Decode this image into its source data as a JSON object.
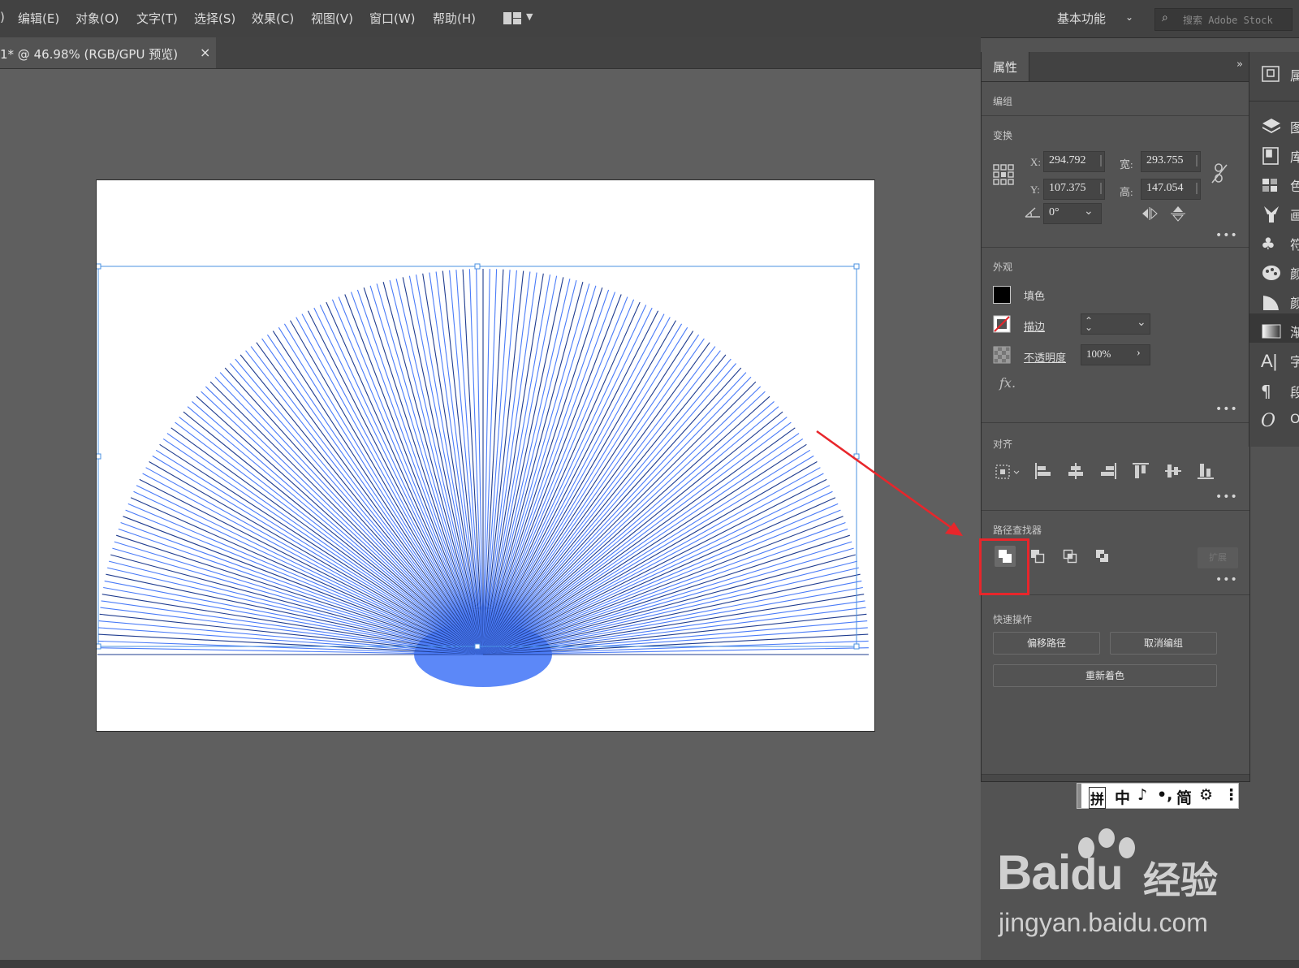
{
  "menu": {
    "items": [
      ")",
      "编辑(E)",
      "对象(O)",
      "文字(T)",
      "选择(S)",
      "效果(C)",
      "视图(V)",
      "窗口(W)",
      "帮助(H)"
    ],
    "workspace_icon": "workspace-grid-icon",
    "essentials": "基本功能",
    "search_placeholder": "搜索 Adobe Stock"
  },
  "document_tab": {
    "title": "1* @ 46.98% (RGB/GPU 预览)",
    "close": "×"
  },
  "properties": {
    "tab_label": "属性",
    "collapse": "»",
    "selection_type": "编组",
    "transform": {
      "title": "变换",
      "x_label": "X:",
      "x_value": "294.792",
      "y_label": "Y:",
      "y_value": "107.375",
      "w_label": "宽:",
      "w_value": "293.755",
      "h_label": "高:",
      "h_value": "147.054",
      "angle_value": "0°"
    },
    "appearance": {
      "title": "外观",
      "fill_label": "填色",
      "stroke_label": "描边",
      "opacity_label": "不透明度",
      "opacity_value": "100%",
      "fx_label": "fx."
    },
    "align": {
      "title": "对齐"
    },
    "pathfinder": {
      "title": "路径查找器",
      "expand_label": "扩展"
    },
    "quick_actions": {
      "title": "快速操作",
      "offset_path": "偏移路径",
      "ungroup": "取消编组",
      "recolor": "重新着色"
    },
    "more": "•••"
  },
  "dock": {
    "items": [
      {
        "icon": "properties-icon",
        "label": "属"
      },
      {
        "icon": "layers-icon",
        "label": "图"
      },
      {
        "icon": "libraries-icon",
        "label": "库"
      },
      {
        "icon": "swatches-icon",
        "label": "色"
      },
      {
        "icon": "brushes-icon",
        "label": "画"
      },
      {
        "icon": "symbols-icon",
        "label": "符"
      },
      {
        "icon": "color-icon",
        "label": "颜"
      },
      {
        "icon": "color-guide-icon",
        "label": "颜"
      },
      {
        "icon": "gradient-icon",
        "label": "渐"
      },
      {
        "icon": "character-icon",
        "label": "字"
      },
      {
        "icon": "paragraph-icon",
        "label": "段"
      },
      {
        "icon": "opentype-icon",
        "label": "O"
      }
    ]
  },
  "ime": {
    "items": [
      "拼",
      "中",
      "♪",
      "•,",
      "简",
      "⚙",
      "⋮"
    ]
  },
  "watermark": {
    "brand": "Bai",
    "brand2": "经验",
    "url": "jingyan.baidu.com"
  },
  "colors": {
    "ray_blue": "#4a7bf7",
    "ray_dark": "#1f3c8f",
    "highlight_red": "#e8262b",
    "selection_blue": "#4a90e2"
  }
}
